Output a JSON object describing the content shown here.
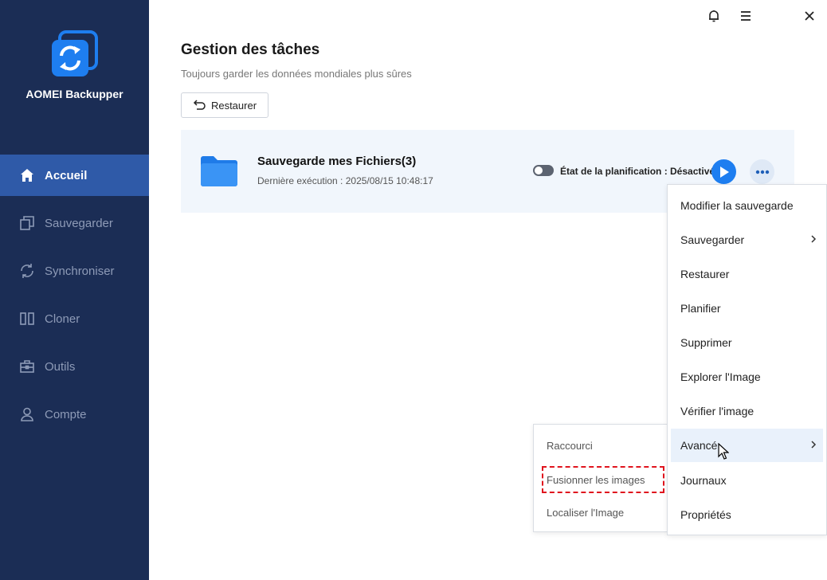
{
  "app": {
    "name": "AOMEI Backupper",
    "accent": "#1e7ef0",
    "sidebar_bg": "#1b2d55"
  },
  "titlebar": {
    "icons": [
      "bell-icon",
      "menu-icon",
      "close-icon"
    ]
  },
  "sidebar": {
    "items": [
      {
        "label": "Accueil",
        "icon": "home-icon",
        "active": true
      },
      {
        "label": "Sauvegarder",
        "icon": "backup-icon",
        "active": false
      },
      {
        "label": "Synchroniser",
        "icon": "sync-icon",
        "active": false
      },
      {
        "label": "Cloner",
        "icon": "clone-icon",
        "active": false
      },
      {
        "label": "Outils",
        "icon": "toolbox-icon",
        "active": false
      },
      {
        "label": "Compte",
        "icon": "user-icon",
        "active": false
      }
    ]
  },
  "main": {
    "title": "Gestion des tâches",
    "subtitle": "Toujours garder les données mondiales plus sûres",
    "restore_button": "Restaurer"
  },
  "task": {
    "name": "Sauvegarde mes Fichiers(3)",
    "last_run": "Dernière exécution : 2025/08/15 10:48:17",
    "schedule_status": "État de la planification : Désactivé",
    "schedule_enabled": false
  },
  "context_menu": {
    "items": [
      {
        "label": "Modifier la sauvegarde",
        "submenu": false
      },
      {
        "label": "Sauvegarder",
        "submenu": true
      },
      {
        "label": "Restaurer",
        "submenu": false
      },
      {
        "label": "Planifier",
        "submenu": false
      },
      {
        "label": "Supprimer",
        "submenu": false
      },
      {
        "label": "Explorer l'Image",
        "submenu": false
      },
      {
        "label": "Vérifier l'image",
        "submenu": false
      },
      {
        "label": "Avancé",
        "submenu": true,
        "hovered": true
      },
      {
        "label": "Journaux",
        "submenu": false
      },
      {
        "label": "Propriétés",
        "submenu": false
      }
    ]
  },
  "sub_menu": {
    "items": [
      {
        "label": "Raccourci"
      },
      {
        "label": "Fusionner les images",
        "highlighted": true
      },
      {
        "label": "Localiser l'Image"
      }
    ]
  }
}
